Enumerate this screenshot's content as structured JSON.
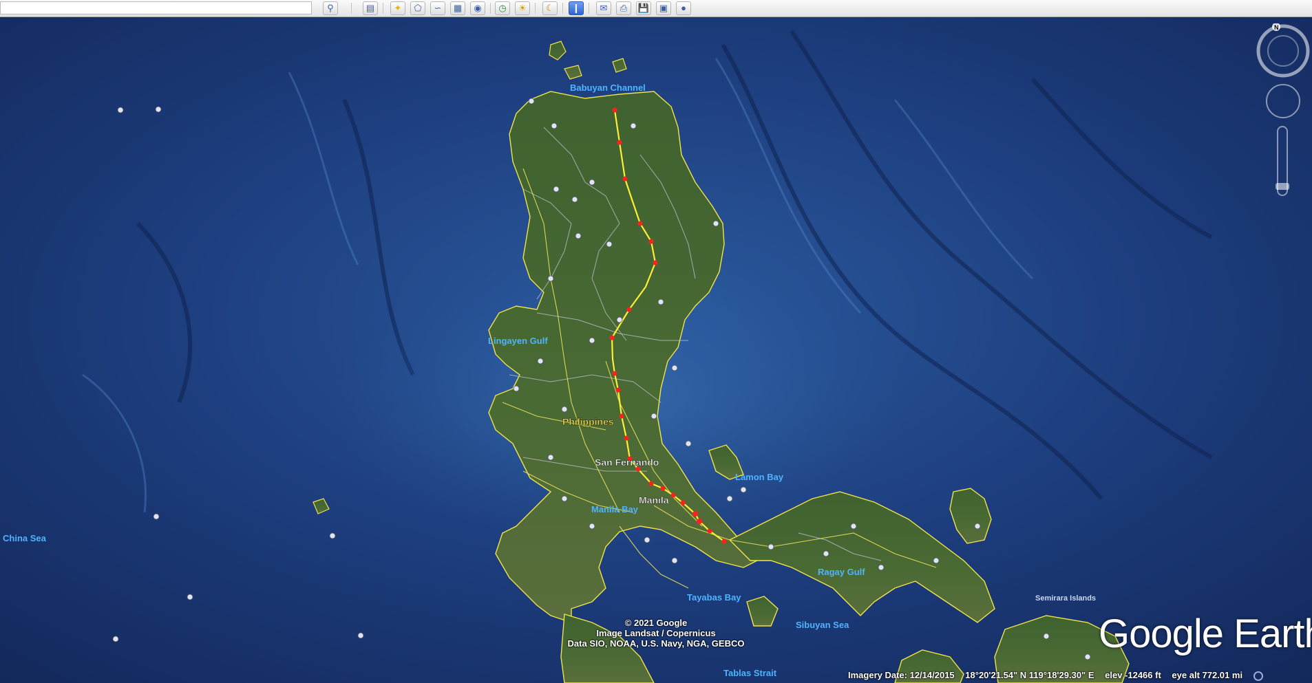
{
  "toolbar": {
    "search_value": "",
    "buttons": [
      "search-icon",
      "separator-grip",
      "sidebar-toggle-icon",
      "add-placemark-icon",
      "add-polygon-icon",
      "add-path-icon",
      "add-overlay-icon",
      "record-tour-icon",
      "historical-imagery-icon",
      "sunlight-icon",
      "switch-to-sky-icon",
      "ruler-icon",
      "email-icon",
      "print-icon",
      "save-image-icon",
      "view-in-maps-icon",
      "earth-view-icon"
    ]
  },
  "map": {
    "places": {
      "philippines": "Philippines",
      "san_fernando": "San Fernando",
      "manila": "Manila"
    },
    "water": {
      "babuyan_channel": "Babuyan Channel",
      "lingayen_gulf": "Lingayen Gulf",
      "lamon_bay": "Lamon Bay",
      "manila_bay": "Manila Bay",
      "china_sea": "China Sea",
      "ragay_gulf": "Ragay Gulf",
      "tayabas_bay": "Tayabas Bay",
      "sibuyan_sea": "Sibuyan Sea",
      "tablas_strait": "Tablas Strait",
      "semirara_islands": "Semirara Islands"
    },
    "colors": {
      "ocean": "#1d3a78",
      "land": "#3a5a2a",
      "route": "#ffee33",
      "route_points": "#ff2020",
      "borders": "#e8e14a",
      "water_label": "#4fb3ff"
    }
  },
  "attribution": {
    "line1": "© 2021 Google",
    "line2": "Image Landsat / Copernicus",
    "line3": "Data SIO, NOAA, U.S. Navy, NGA, GEBCO"
  },
  "status": {
    "imagery_date": "Imagery Date: 12/14/2015",
    "coords": "18°20'21.54\" N 119°18'29.30\" E",
    "elevation": "elev -12466 ft",
    "eye_alt": "eye alt 772.01 mi"
  },
  "branding": {
    "logo": "Google Earth"
  },
  "navigation": {
    "north": "N"
  }
}
